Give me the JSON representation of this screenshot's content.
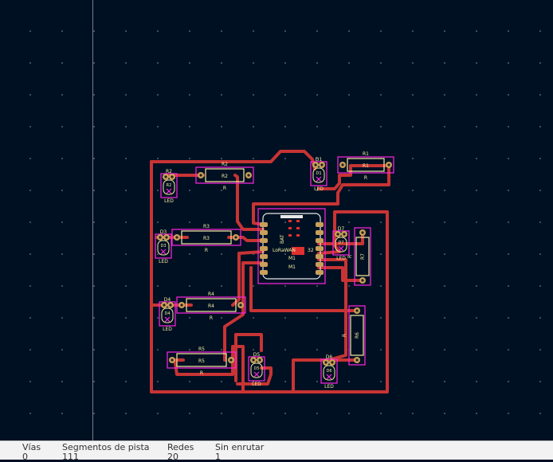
{
  "colors": {
    "background": "#001023",
    "track": "#c83434",
    "courtyard": "#ff26e2",
    "silkscreen": "#f2eda1",
    "pad": "#c8a05a",
    "fab": "#d0d0d0"
  },
  "components": {
    "r1": {
      "ref": "R1",
      "value": "R"
    },
    "r2": {
      "ref": "R2",
      "value": "R"
    },
    "r3": {
      "ref": "R3",
      "value": "R"
    },
    "r4": {
      "ref": "R4",
      "value": "R"
    },
    "r5": {
      "ref": "R5",
      "value": "R"
    },
    "r6": {
      "ref": "R6",
      "value": "R"
    },
    "r7": {
      "ref": "R7",
      "value": "R"
    },
    "d1": {
      "ref": "D1",
      "value": "LED"
    },
    "d2": {
      "ref": "R2",
      "value": "LED"
    },
    "d3": {
      "ref": "D3",
      "value": "LED"
    },
    "d4": {
      "ref": "D4",
      "value": "LED"
    },
    "d5": {
      "ref": "D5",
      "value": "LED"
    },
    "d6": {
      "ref": "D6",
      "value": "LED"
    },
    "d7": {
      "ref": "D7",
      "value": "LED"
    },
    "m1": {
      "ref": "M1",
      "value": "M1",
      "side_label": "BAT",
      "chip_label": "LoRaWAN",
      "extra": "32"
    }
  },
  "status_bar": {
    "vias_label": "Vías",
    "vias_value": "0",
    "segments_label": "Segmentos de pista",
    "segments_value": "111",
    "nets_label": "Redes",
    "nets_value": "20",
    "unrouted_label": "Sin enrutar",
    "unrouted_value": "1"
  }
}
